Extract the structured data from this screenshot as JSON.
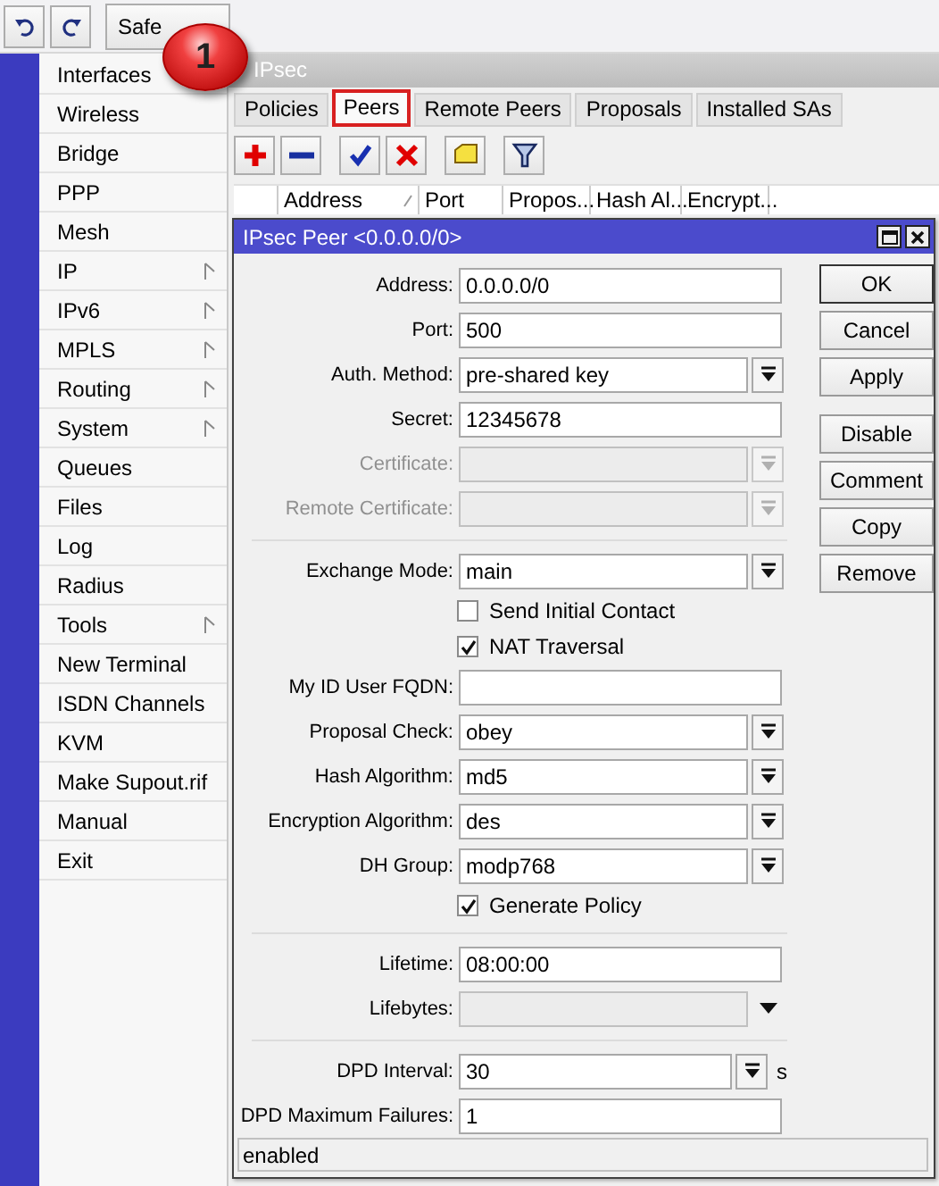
{
  "top_bar": {
    "safe_mode_button": "Safe",
    "callout": "1"
  },
  "sidebar": {
    "items": [
      {
        "label": "Interfaces",
        "submenu": false
      },
      {
        "label": "Wireless",
        "submenu": false
      },
      {
        "label": "Bridge",
        "submenu": false
      },
      {
        "label": "PPP",
        "submenu": false
      },
      {
        "label": "Mesh",
        "submenu": false
      },
      {
        "label": "IP",
        "submenu": true
      },
      {
        "label": "IPv6",
        "submenu": true
      },
      {
        "label": "MPLS",
        "submenu": true
      },
      {
        "label": "Routing",
        "submenu": true
      },
      {
        "label": "System",
        "submenu": true
      },
      {
        "label": "Queues",
        "submenu": false
      },
      {
        "label": "Files",
        "submenu": false
      },
      {
        "label": "Log",
        "submenu": false
      },
      {
        "label": "Radius",
        "submenu": false
      },
      {
        "label": "Tools",
        "submenu": true
      },
      {
        "label": "New Terminal",
        "submenu": false
      },
      {
        "label": "ISDN Channels",
        "submenu": false
      },
      {
        "label": "KVM",
        "submenu": false
      },
      {
        "label": "Make Supout.rif",
        "submenu": false
      },
      {
        "label": "Manual",
        "submenu": false
      },
      {
        "label": "Exit",
        "submenu": false
      }
    ]
  },
  "window": {
    "title": "IPsec",
    "tabs": [
      {
        "label": "Policies",
        "selected": false
      },
      {
        "label": "Peers",
        "selected": true
      },
      {
        "label": "Remote Peers",
        "selected": false
      },
      {
        "label": "Proposals",
        "selected": false
      },
      {
        "label": "Installed SAs",
        "selected": false
      }
    ],
    "columns": [
      "Address",
      "Port",
      "Propos...",
      "Hash Al...",
      "Encrypt..."
    ]
  },
  "dialog": {
    "title": "IPsec Peer <0.0.0.0/0>",
    "rows": [
      {
        "kind": "text",
        "label": "Address:",
        "value": "0.0.0.0/0",
        "disabled": false
      },
      {
        "kind": "text",
        "label": "Port:",
        "value": "500",
        "disabled": false
      },
      {
        "kind": "select",
        "label": "Auth. Method:",
        "value": "pre-shared key",
        "disabled": false
      },
      {
        "kind": "text",
        "label": "Secret:",
        "value": "12345678",
        "disabled": false
      },
      {
        "kind": "select",
        "label": "Certificate:",
        "disabled": true
      },
      {
        "kind": "select",
        "label": "Remote Certificate:",
        "disabled": true
      },
      {
        "kind": "separator"
      },
      {
        "kind": "select",
        "label": "Exchange Mode:",
        "value": "main",
        "disabled": false
      },
      {
        "kind": "check",
        "label": "Send Initial Contact",
        "checked": false
      },
      {
        "kind": "check",
        "label": "NAT Traversal",
        "checked": true
      },
      {
        "kind": "text",
        "label": "My ID User FQDN:",
        "disabled": false
      },
      {
        "kind": "select",
        "label": "Proposal Check:",
        "value": "obey",
        "disabled": false
      },
      {
        "kind": "select",
        "label": "Hash Algorithm:",
        "value": "md5",
        "disabled": false
      },
      {
        "kind": "select",
        "label": "Encryption Algorithm:",
        "value": "des",
        "disabled": false
      },
      {
        "kind": "select",
        "label": "DH Group:",
        "value": "modp768",
        "disabled": false
      },
      {
        "kind": "check",
        "label": "Generate Policy",
        "checked": true
      },
      {
        "kind": "separator"
      },
      {
        "kind": "text",
        "label": "Lifetime:",
        "value": "08:00:00",
        "disabled": false
      },
      {
        "kind": "combo",
        "label": "Lifebytes:"
      },
      {
        "kind": "separator"
      },
      {
        "kind": "select",
        "label": "DPD Interval:",
        "value": "30",
        "unit": "s",
        "disabled": false
      },
      {
        "kind": "text",
        "label": "DPD Maximum Failures:",
        "value": "1",
        "disabled": false
      }
    ],
    "button_groups": [
      [
        {
          "label": "OK",
          "default": true
        },
        {
          "label": "Cancel",
          "default": false
        },
        {
          "label": "Apply",
          "default": false
        }
      ],
      [
        {
          "label": "Disable",
          "default": false
        },
        {
          "label": "Comment",
          "default": false
        },
        {
          "label": "Copy",
          "default": false
        },
        {
          "label": "Remove",
          "default": false
        }
      ]
    ],
    "status": "enabled"
  }
}
